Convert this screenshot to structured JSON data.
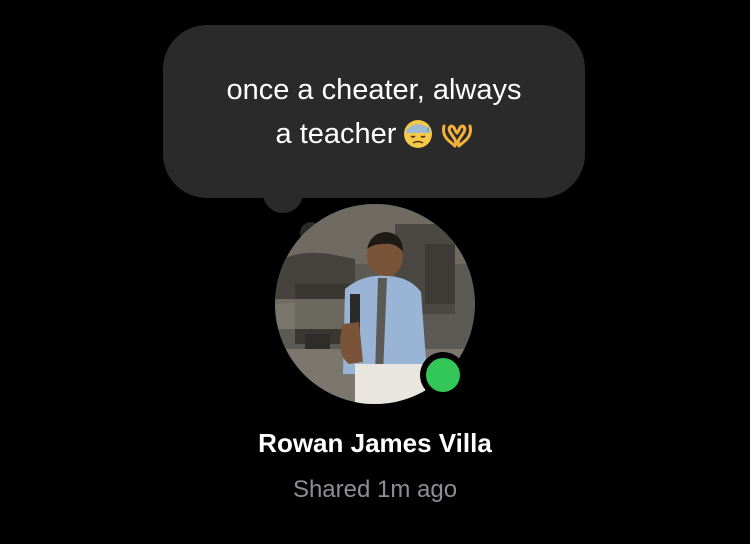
{
  "note": {
    "line1": "once a cheater, always",
    "line2_text": "a teacher",
    "emojis": [
      "downcast-face-with-sweat-icon",
      "heart-hands-icon"
    ]
  },
  "profile": {
    "name": "Rowan James Villa",
    "status": "Shared 1m ago",
    "online": true,
    "online_color": "#33c759"
  },
  "colors": {
    "background": "#000000",
    "bubble": "#2a2a2a",
    "secondary_text": "#8e8e93"
  }
}
